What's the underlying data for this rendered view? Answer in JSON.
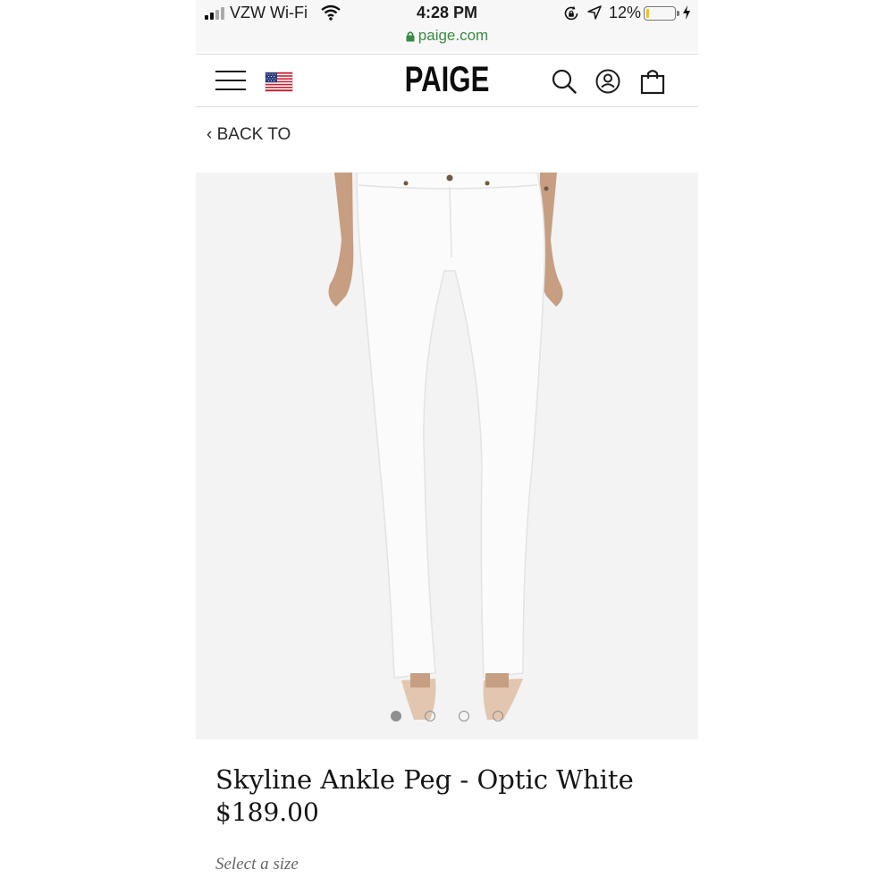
{
  "status_bar": {
    "carrier": "VZW Wi-Fi",
    "time": "4:28 PM",
    "url": "paige.com",
    "battery_percent": "12%",
    "battery_level": 0.12,
    "icons": [
      "signal-icon",
      "wifi-icon",
      "rotation-lock-icon",
      "location-icon",
      "battery-icon",
      "charging-icon",
      "lock-icon"
    ]
  },
  "header": {
    "logo": "PAIGE",
    "icons": [
      "menu-icon",
      "us-flag-icon",
      "search-icon",
      "account-icon",
      "shopping-bag-icon"
    ]
  },
  "nav": {
    "back_label": "BACK TO"
  },
  "gallery": {
    "image_count": 4,
    "active_index": 0
  },
  "product": {
    "title": "Skyline Ankle Peg - Optic White",
    "price": "$189.00",
    "size_prompt": "Select a size"
  },
  "colors": {
    "url_green": "#3a8b46",
    "battery_yellow": "#f2c200",
    "image_bg": "#f3f3f3"
  }
}
